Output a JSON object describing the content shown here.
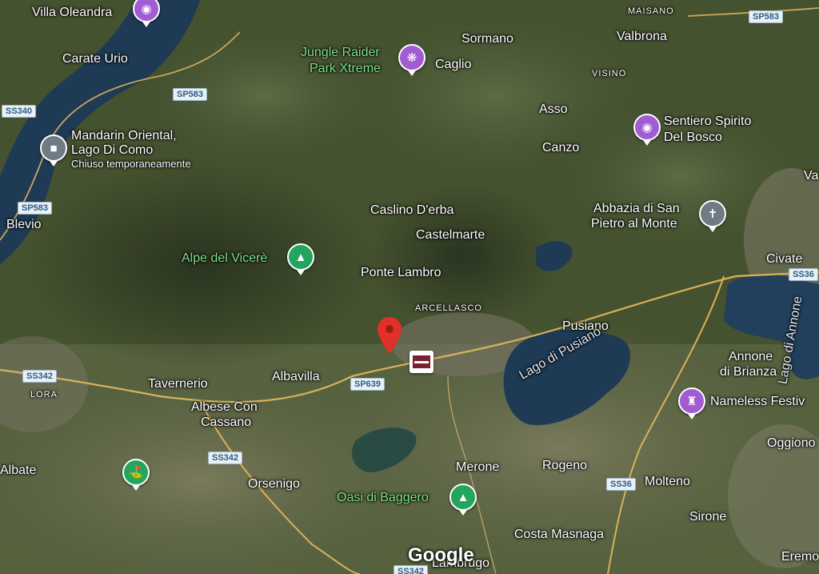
{
  "map": {
    "brand": "Google",
    "colors": {
      "water": "#1e3a55",
      "poi_purple": "#a25cd1",
      "poi_green": "#24a55e",
      "marker_red": "#e0302a",
      "shield_text": "#2b5d84"
    },
    "places": {
      "villa_oleandra": "Villa Oleandra",
      "carate_urio": "Carate Urio",
      "mandarin_line1": "Mandarin Oriental,",
      "mandarin_line2": "Lago Di Como",
      "mandarin_status": "Chiuso temporaneamente",
      "blevio": "Blevio",
      "alpe_vicere": "Alpe del Vicerè",
      "jungle_line1": "Jungle Raider",
      "jungle_line2": "Park Xtreme",
      "sormano": "Sormano",
      "caglio": "Caglio",
      "maisano": "MAISANO",
      "valbrona": "Valbrona",
      "visino": "VISINO",
      "asso": "Asso",
      "canzo": "Canzo",
      "sentiero_line1": "Sentiero Spirito",
      "sentiero_line2": "Del Bosco",
      "va": "Va",
      "abbazia_line1": "Abbazia di San",
      "abbazia_line2": "Pietro al Monte",
      "caslino": "Caslino D'erba",
      "castelmarte": "Castelmarte",
      "ponte_lambro": "Ponte Lambro",
      "arcellasco": "ARCELLASCO",
      "civate": "Civate",
      "pusiano": "Pusiano",
      "lago_pusiano": "Lago di Pusiano",
      "annone_line1": "Annone",
      "annone_line2": "di Brianza",
      "lago_annone": "Lago di Annone",
      "tavernerio": "Tavernerio",
      "albavilla": "Albavilla",
      "lora": "LORA",
      "albese_line1": "Albese Con",
      "albese_line2": "Cassano",
      "nameless": "Nameless Festiv",
      "oggiono": "Oggiono",
      "albate": "Albate",
      "orsenigo": "Orsenigo",
      "merone": "Merone",
      "rogeno": "Rogeno",
      "molteno": "Molteno",
      "oasi": "Oasi di Baggero",
      "sirone": "Sirone",
      "costa": "Costa Masnaga",
      "lambrugo": "Lambrugo",
      "eremo": "Eremo"
    },
    "roads": {
      "sp583_a": "SP583",
      "sp583_b": "SP583",
      "sp583_c": "SP583",
      "ss340": "SS340",
      "ss342_a": "SS342",
      "ss342_b": "SS342",
      "sp639": "SP639",
      "ss36_a": "SS36",
      "ss36_b": "SS36",
      "ss342_c": "SS342"
    }
  }
}
